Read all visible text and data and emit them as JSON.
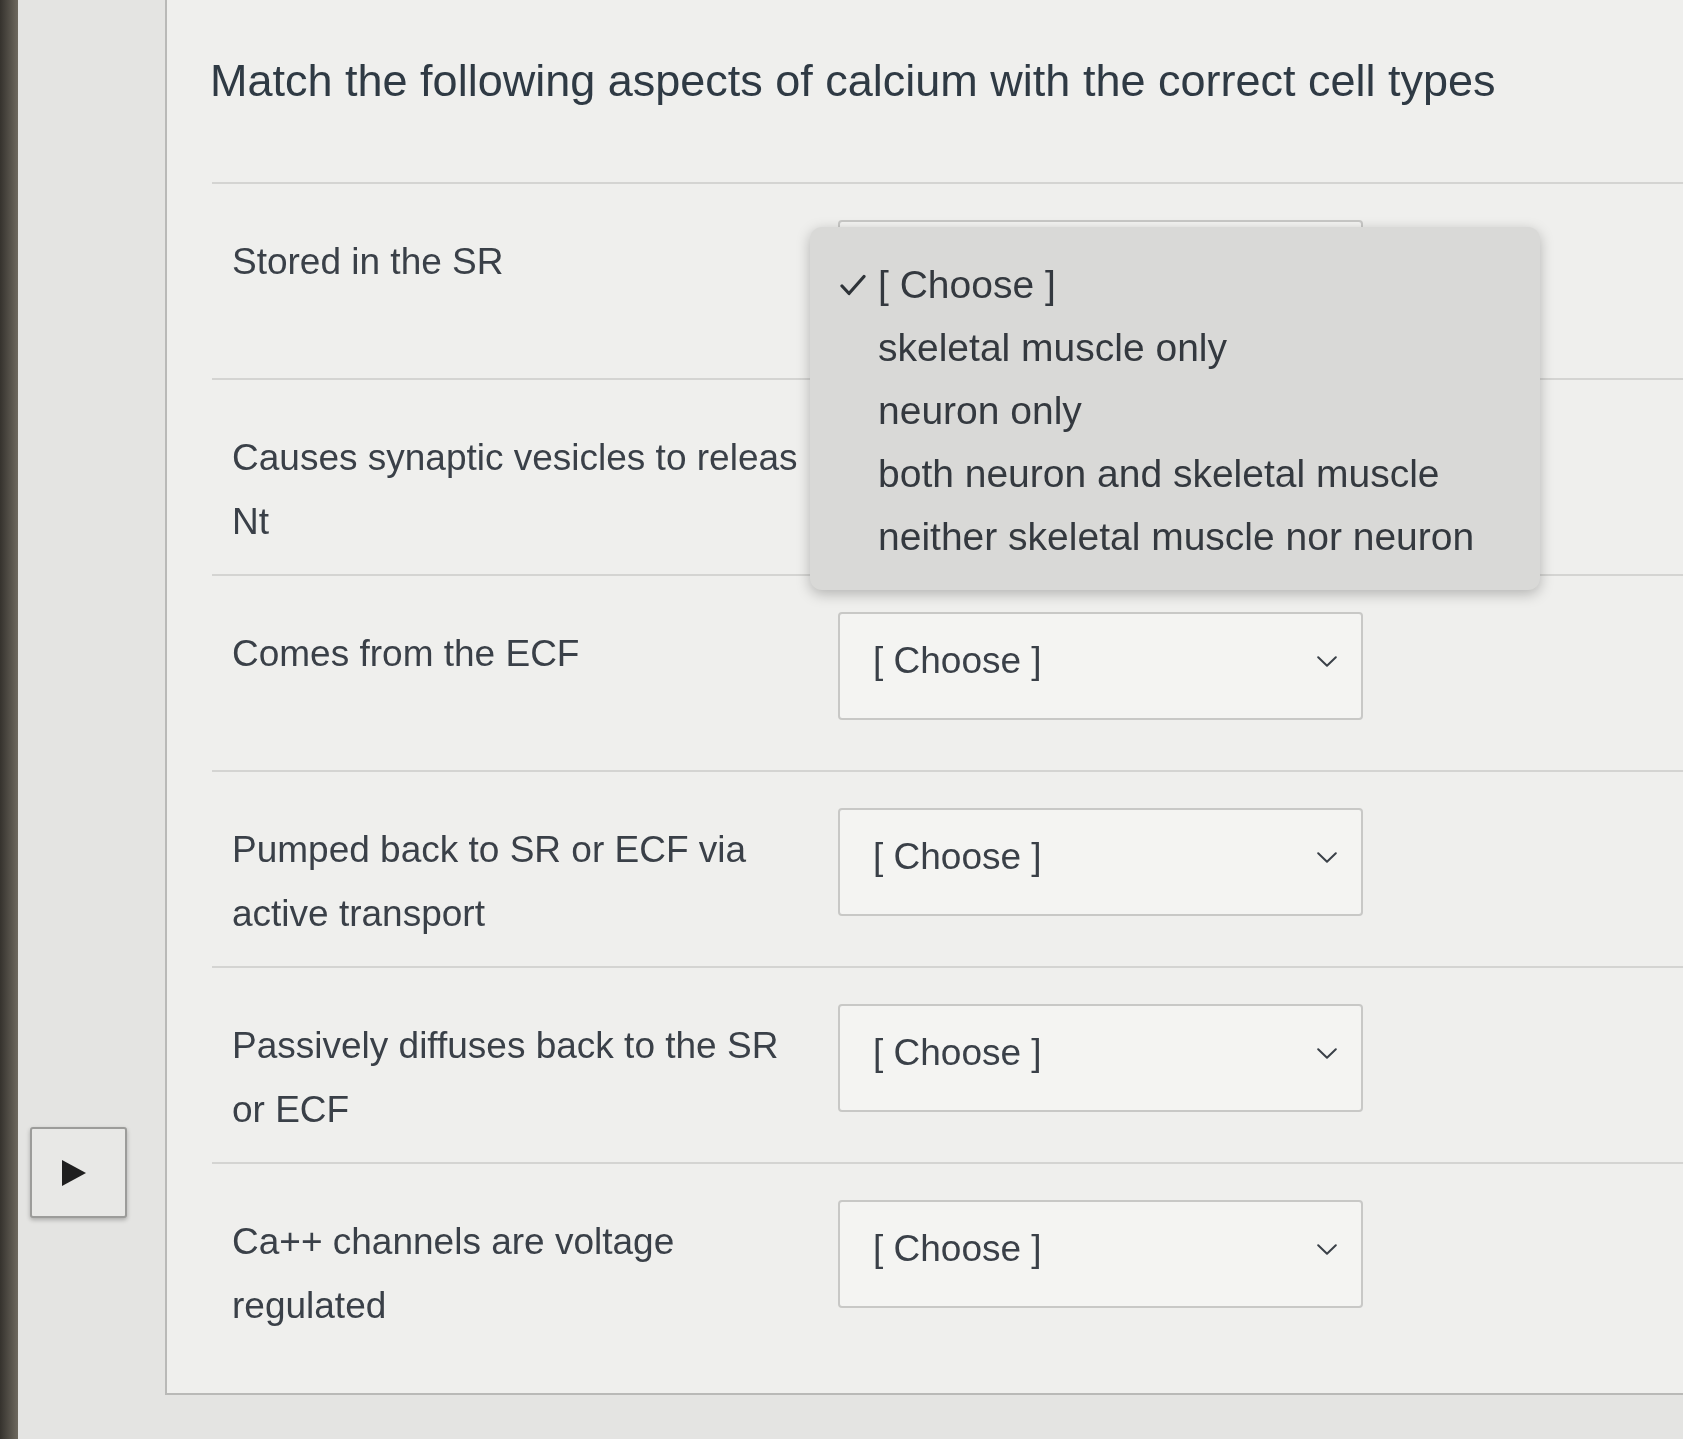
{
  "title": "Match the following aspects of calcium with the correct cell types",
  "rows": [
    {
      "lines": [
        "Stored in the SR"
      ],
      "select": {
        "open": true,
        "options": [
          {
            "label": "[ Choose ]",
            "selected": true
          },
          {
            "label": "skeletal muscle only",
            "selected": false
          },
          {
            "label": "neuron only",
            "selected": false
          },
          {
            "label": "both neuron and skeletal muscle",
            "selected": false
          },
          {
            "label": "neither skeletal muscle nor neuron",
            "selected": false
          }
        ]
      }
    },
    {
      "lines": [
        "Causes synaptic vesicles to releas",
        "Nt"
      ]
    },
    {
      "lines": [
        "Comes from the ECF"
      ],
      "select": {
        "value": "[ Choose ]",
        "open": false
      }
    },
    {
      "lines": [
        "Pumped back to SR or ECF via",
        "active transport"
      ],
      "select": {
        "value": "[ Choose ]",
        "open": false
      }
    },
    {
      "lines": [
        "Passively diffuses back to the SR",
        "or ECF"
      ],
      "select": {
        "value": "[ Choose ]",
        "open": false
      }
    },
    {
      "lines": [
        "Ca++ channels are voltage",
        "regulated"
      ],
      "select": {
        "value": "[ Choose ]",
        "open": false
      }
    }
  ]
}
